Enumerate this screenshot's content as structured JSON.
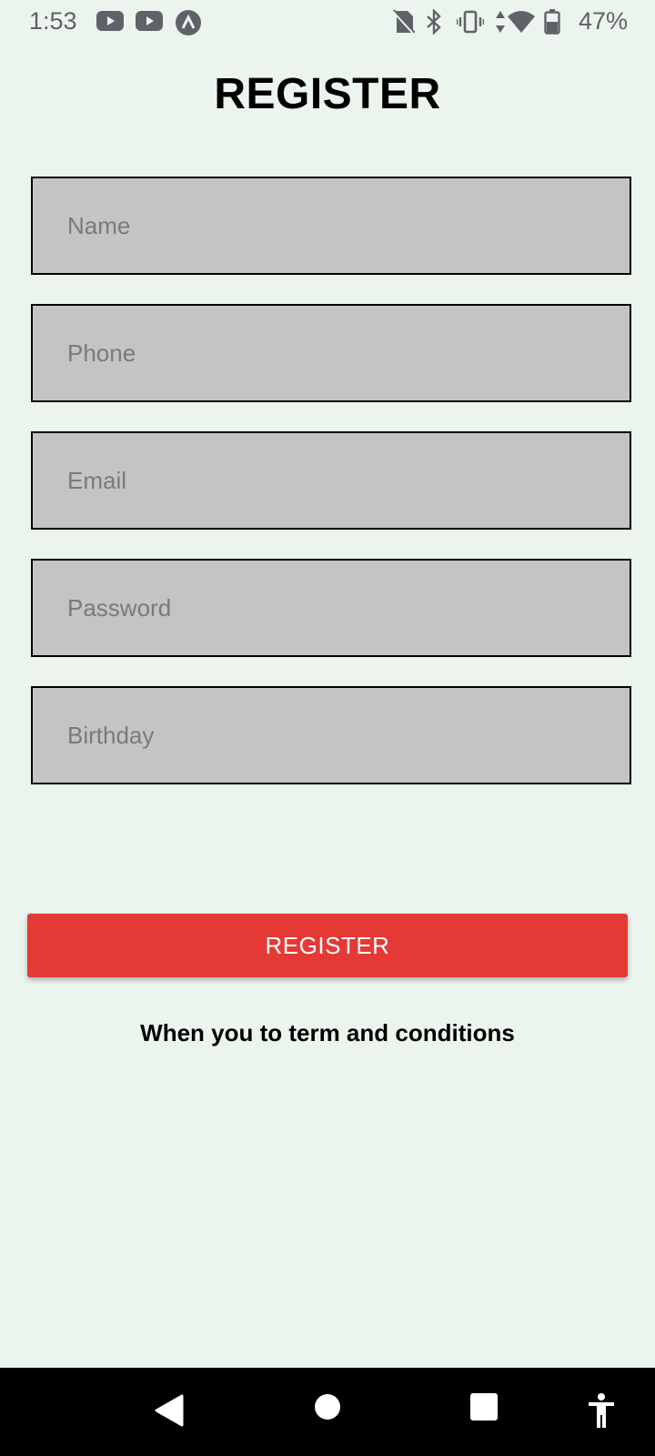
{
  "status_bar": {
    "time": "1:53",
    "battery": "47%",
    "icons": [
      "youtube-icon",
      "youtube-icon",
      "app-notification-icon",
      "no-sim-icon",
      "bluetooth-icon",
      "vibrate-icon",
      "data-arrows-icon",
      "wifi-icon",
      "battery-icon"
    ]
  },
  "title": "REGISTER",
  "form": {
    "name_placeholder": "Name",
    "phone_placeholder": "Phone",
    "email_placeholder": "Email",
    "password_placeholder": "Password",
    "birthday_placeholder": "Birthday"
  },
  "register_button": "REGISTER",
  "terms_text": "When you to term and conditions",
  "nav_bar": {
    "buttons": [
      "back-icon",
      "home-icon",
      "recents-icon",
      "accessibility-icon"
    ]
  },
  "colors": {
    "background": "#ebf5ee",
    "field_background": "#c4c4c4",
    "button": "#e53935",
    "nav_bar": "#000000"
  }
}
